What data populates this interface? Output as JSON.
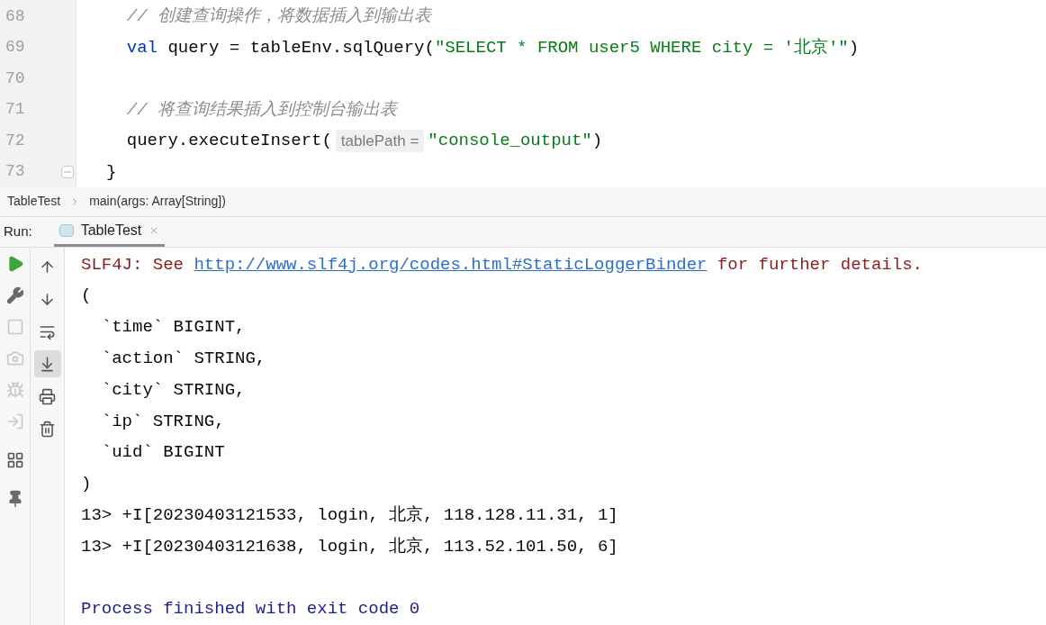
{
  "editor": {
    "lines": [
      {
        "number": "68",
        "segments": [
          {
            "kind": "comment",
            "text": "  // 创建查询操作，将数据插入到输出表"
          }
        ]
      },
      {
        "number": "69",
        "segments": [
          {
            "kind": "keyword",
            "text": "  val"
          },
          {
            "kind": "plain",
            "text": " query = tableEnv.sqlQuery("
          },
          {
            "kind": "string",
            "text": "\"SELECT * FROM user5 WHERE city = '北京'\""
          },
          {
            "kind": "plain",
            "text": ")"
          }
        ]
      },
      {
        "number": "70"
      },
      {
        "number": "71",
        "segments": [
          {
            "kind": "comment",
            "text": "  // 将查询结果插入到控制台输出表"
          }
        ]
      },
      {
        "number": "72",
        "segments": [
          {
            "kind": "plain",
            "text": "  query.executeInsert("
          },
          {
            "kind": "hint",
            "text": "tablePath ="
          },
          {
            "kind": "string",
            "text": "\"console_output\""
          },
          {
            "kind": "plain",
            "text": ")"
          }
        ]
      },
      {
        "number": "73",
        "fold": true,
        "segments": [
          {
            "kind": "plain",
            "text": "}"
          }
        ]
      }
    ]
  },
  "breadcrumb": [
    "TableTest",
    "main(args: Array[String])"
  ],
  "run_panel": {
    "label": "Run:",
    "tabs": [
      {
        "label": "TableTest",
        "selected": true
      }
    ],
    "left_toolbar": [
      {
        "disabled": false
      },
      {
        "disabled": false
      },
      {
        "disabled": true
      },
      {
        "disabled": true
      },
      {
        "disabled": true
      },
      {
        "disabled": true
      },
      {
        "disabled": false
      },
      {
        "disabled": false
      }
    ],
    "right_toolbar": [
      {
        "on": false
      },
      {
        "on": false
      },
      {
        "on": false
      },
      {
        "on": true
      },
      {
        "on": false
      },
      {
        "on": false
      }
    ],
    "console": [
      [
        {
          "kind": "error",
          "text": "SLF4J: See "
        },
        {
          "kind": "link",
          "text": "http://www.slf4j.org/codes.html#StaticLoggerBinder"
        },
        {
          "kind": "error",
          "text": " for further details."
        }
      ],
      [
        {
          "kind": "plain",
          "text": "("
        }
      ],
      [
        {
          "kind": "plain",
          "text": "  `time` BIGINT,"
        }
      ],
      [
        {
          "kind": "plain",
          "text": "  `action` STRING,"
        }
      ],
      [
        {
          "kind": "plain",
          "text": "  `city` STRING,"
        }
      ],
      [
        {
          "kind": "plain",
          "text": "  `ip` STRING,"
        }
      ],
      [
        {
          "kind": "plain",
          "text": "  `uid` BIGINT"
        }
      ],
      [
        {
          "kind": "plain",
          "text": ")"
        }
      ],
      [
        {
          "kind": "plain",
          "text": "13> +I[20230403121533, login, 北京, 118.128.11.31, 1]"
        }
      ],
      [
        {
          "kind": "plain",
          "text": "13> +I[20230403121638, login, 北京, 113.52.101.50, 6]"
        }
      ],
      [
        {
          "kind": "blank"
        }
      ],
      [
        {
          "kind": "process",
          "text": "Process finished with exit code 0"
        }
      ]
    ]
  }
}
